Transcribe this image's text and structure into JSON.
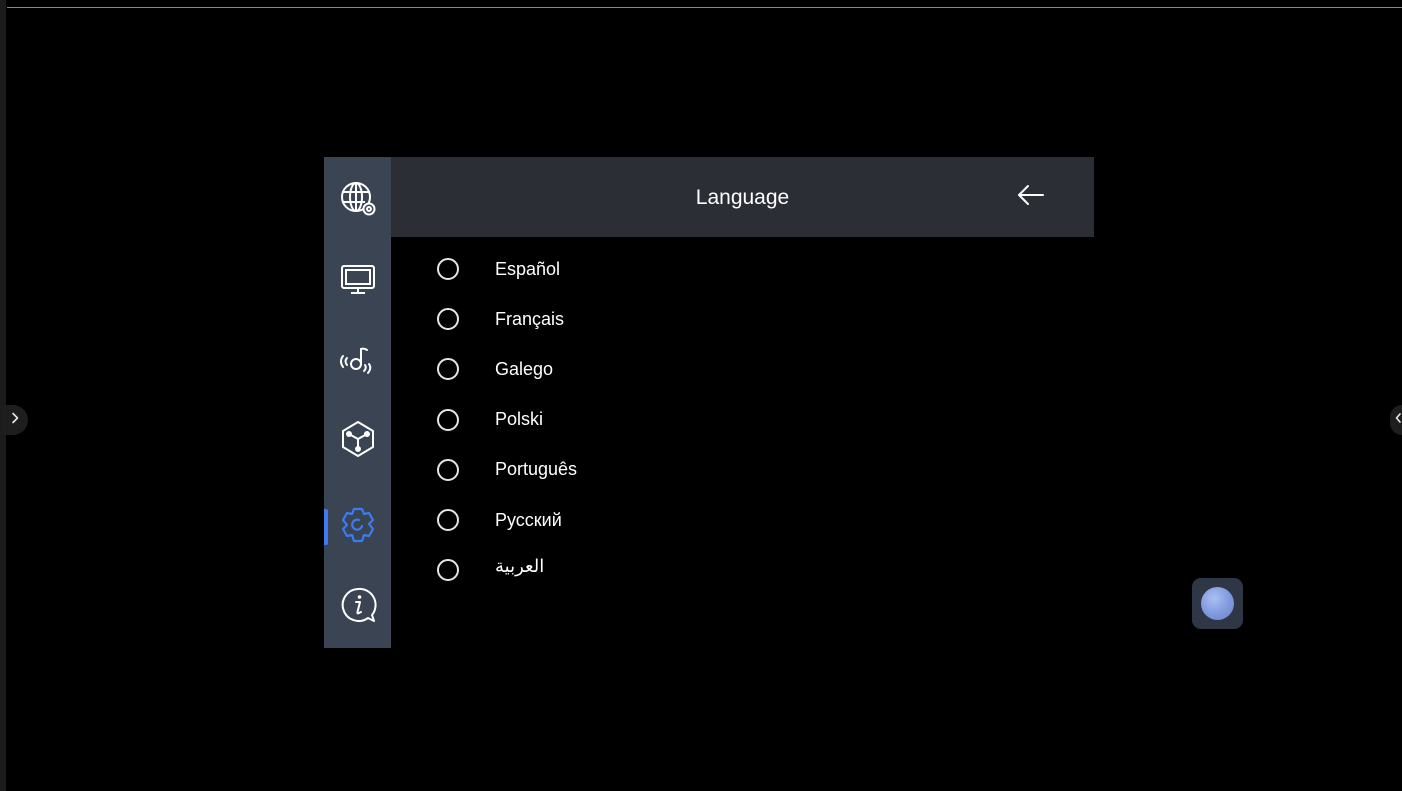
{
  "header": {
    "title": "Language",
    "back_icon": "arrow-left-icon"
  },
  "sidebar": {
    "items": [
      {
        "icon": "globe-settings-icon",
        "active": false
      },
      {
        "icon": "monitor-icon",
        "active": false
      },
      {
        "icon": "audio-broadcast-icon",
        "active": false
      },
      {
        "icon": "cube-icon",
        "active": false
      },
      {
        "icon": "settings-gear-icon",
        "active": true
      },
      {
        "icon": "info-chat-icon",
        "active": false
      }
    ],
    "active_color": "#3d7bf2"
  },
  "languages": [
    {
      "label": "Español",
      "selected": false
    },
    {
      "label": "Français",
      "selected": false
    },
    {
      "label": "Galego",
      "selected": false
    },
    {
      "label": "Polski",
      "selected": false
    },
    {
      "label": "Português",
      "selected": false
    },
    {
      "label": "Русский",
      "selected": false
    },
    {
      "label": "العربية",
      "selected": false
    }
  ],
  "edge_controls": {
    "left_icon": "chevron-right-icon",
    "right_icon": "chevron-left-icon"
  },
  "floating_button": {
    "icon": "floating-ball-icon"
  }
}
